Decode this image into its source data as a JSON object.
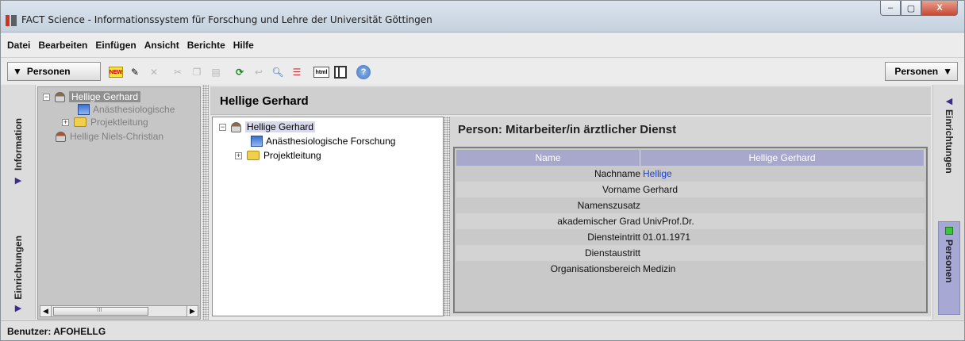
{
  "window": {
    "title": "FACT Science - Informationssystem für Forschung und Lehre der Universität Göttingen",
    "controls": {
      "minimize": "–",
      "maximize": "▢",
      "close": "X"
    }
  },
  "menu": [
    "Datei",
    "Bearbeiten",
    "Einfügen",
    "Ansicht",
    "Berichte",
    "Hilfe"
  ],
  "toolbar": {
    "left_selector": "Personen",
    "right_selector": "Personen",
    "new_label": "NEW",
    "html_label": "html",
    "help_label": "?"
  },
  "left_tabs": {
    "information": "Information",
    "einrichtungen": "Einrichtungen"
  },
  "right_tabs": {
    "einrichtungen": "Einrichtungen",
    "personen": "Personen"
  },
  "nav_tree": {
    "items": [
      {
        "label": "Hellige Gerhard"
      },
      {
        "label": "Anästhesiologische"
      },
      {
        "label": "Projektleitung"
      },
      {
        "label": "Hellige Niels-Christian"
      }
    ],
    "scroll_thumb": "III"
  },
  "main": {
    "title": "Hellige Gerhard",
    "tree": [
      {
        "label": "Hellige Gerhard"
      },
      {
        "label": "Anästhesiologische Forschung"
      },
      {
        "label": "Projektleitung"
      }
    ],
    "detail": {
      "title": "Person: Mitarbeiter/in ärztlicher Dienst",
      "header": {
        "col1": "Name",
        "col2": "Hellige Gerhard"
      },
      "rows": [
        {
          "key": "Nachname",
          "value": "Hellige"
        },
        {
          "key": "Vorname",
          "value": "Gerhard"
        },
        {
          "key": "Namenszusatz",
          "value": ""
        },
        {
          "key": "akademischer Grad",
          "value": "UnivProf.Dr."
        },
        {
          "key": "Diensteintritt",
          "value": "01.01.1971"
        },
        {
          "key": "Dienstaustritt",
          "value": ""
        },
        {
          "key": "Organisationsbereich",
          "value": "Medizin"
        }
      ]
    }
  },
  "status": {
    "user": "Benutzer: AFOHELLG"
  }
}
